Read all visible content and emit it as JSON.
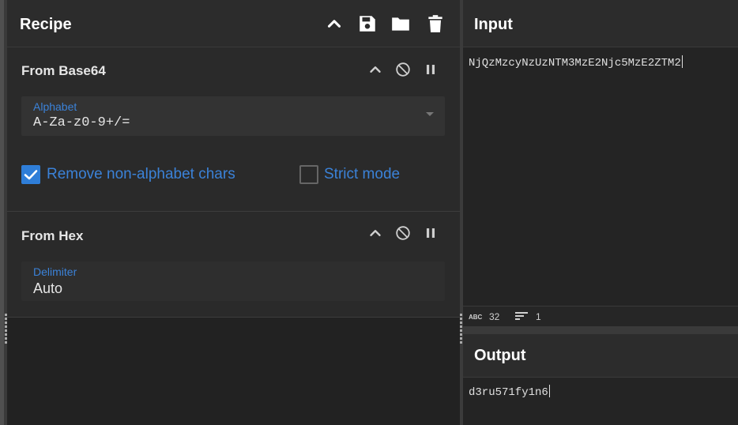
{
  "recipe": {
    "title": "Recipe",
    "header_icons": [
      "chevron-up-icon",
      "save-icon",
      "folder-icon",
      "trash-icon"
    ],
    "operations": [
      {
        "title": "From Base64",
        "alphabet_label": "Alphabet",
        "alphabet_value": "A-Za-z0-9+/=",
        "remove_non_alphabet_label": "Remove non-alphabet chars",
        "remove_non_alphabet_checked": true,
        "strict_mode_label": "Strict mode",
        "strict_mode_checked": false
      },
      {
        "title": "From Hex",
        "delimiter_label": "Delimiter",
        "delimiter_value": "Auto"
      }
    ]
  },
  "input": {
    "title": "Input",
    "text": "NjQzMzcyNzUzNTM3MzE2Njc5MzE2ZTM2",
    "char_count": "32",
    "line_count": "1"
  },
  "output": {
    "title": "Output",
    "text": "d3ru571fy1n6"
  },
  "colors": {
    "accent": "#2f7ed8",
    "label_blue": "#3b82d8",
    "background": "#202020"
  }
}
